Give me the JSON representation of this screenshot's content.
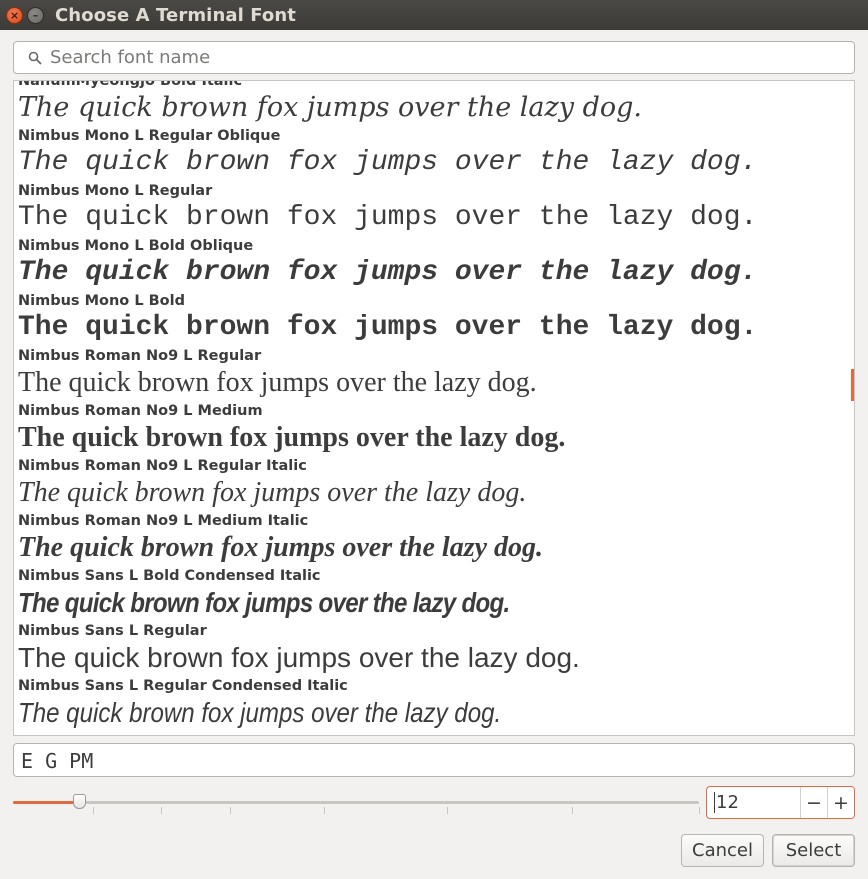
{
  "window": {
    "title": "Choose A Terminal Font",
    "close_glyph": "×",
    "minimize_glyph": "–"
  },
  "search": {
    "placeholder": "Search font name",
    "value": ""
  },
  "fonts": [
    {
      "name": "NanumMyeongjo Bold Italic",
      "sample": "The quick brown fox jumps over the lazy dog.",
      "style": "f-serif-italic"
    },
    {
      "name": "Nimbus Mono L Regular Oblique",
      "sample": "The quick brown fox jumps over the lazy dog.",
      "style": "f-mono-obl"
    },
    {
      "name": "Nimbus Mono L Regular",
      "sample": "The quick brown fox jumps over the lazy dog.",
      "style": "f-mono"
    },
    {
      "name": "Nimbus Mono L Bold Oblique",
      "sample": "The quick brown fox jumps over the lazy dog.",
      "style": "f-mono-bold-obl"
    },
    {
      "name": "Nimbus Mono L Bold",
      "sample": "The quick brown fox jumps over the lazy dog.",
      "style": "f-mono-bold"
    },
    {
      "name": "Nimbus Roman No9 L Regular",
      "sample": "The quick brown fox jumps over the lazy dog.",
      "style": "f-roman"
    },
    {
      "name": "Nimbus Roman No9 L Medium",
      "sample": "The quick brown fox jumps over the lazy dog.",
      "style": "f-roman-bold"
    },
    {
      "name": "Nimbus Roman No9 L Regular Italic",
      "sample": "The quick brown fox jumps over the lazy dog.",
      "style": "f-roman-italic"
    },
    {
      "name": "Nimbus Roman No9 L Medium Italic",
      "sample": "The quick brown fox jumps over the lazy dog.",
      "style": "f-roman-bold-italic"
    },
    {
      "name": "Nimbus Sans L Bold Condensed Italic",
      "sample": "The quick brown fox jumps over the lazy dog.",
      "style": "f-sans-cond-bold-italic"
    },
    {
      "name": "Nimbus Sans L Regular",
      "sample": "The quick brown fox jumps over the lazy dog.",
      "style": "f-sans"
    },
    {
      "name": "Nimbus Sans L Regular Condensed Italic",
      "sample": "The quick brown fox jumps over the lazy dog.",
      "style": "f-sans-cond-italic"
    }
  ],
  "preview": {
    "value": "E G PM"
  },
  "size": {
    "value": "12",
    "slider_fraction": 0.097,
    "decrement_label": "−",
    "increment_label": "+"
  },
  "buttons": {
    "cancel": "Cancel",
    "select": "Select"
  },
  "colors": {
    "accent": "#e06b3f",
    "titlebar": "#3c3b37"
  },
  "icons": {
    "search": "search-icon",
    "close": "close-icon",
    "minimize": "minimize-icon"
  }
}
